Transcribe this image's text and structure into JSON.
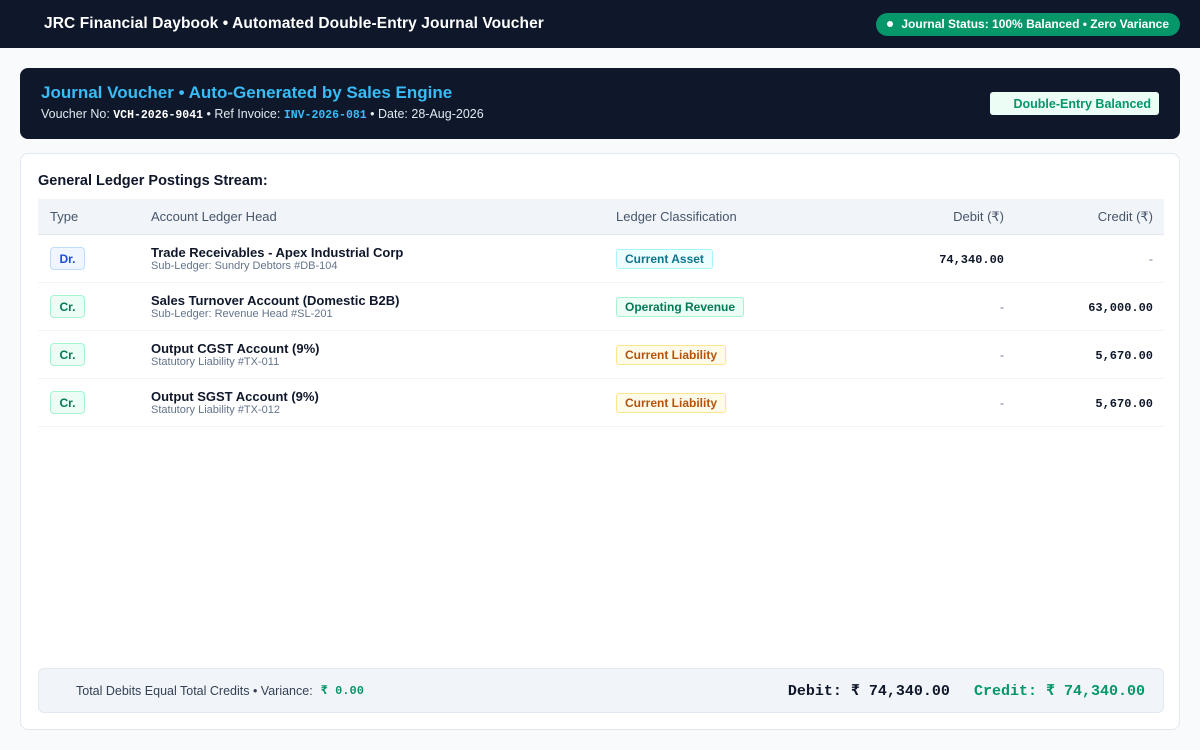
{
  "header": {
    "title": "JRC Financial Daybook • Automated Double-Entry Journal Voucher",
    "status_label": "Journal Status: 100% Balanced • Zero Variance"
  },
  "voucher": {
    "title": "Journal Voucher • Auto-Generated by Sales Engine",
    "voucher_no_label": "Voucher No:",
    "voucher_no": "VCH-2026-9041",
    "ref_invoice_label": "Ref Invoice:",
    "ref_invoice": "INV-2026-081",
    "date_label": "Date:",
    "date": "28-Aug-2026",
    "badge": "Double-Entry Balanced"
  },
  "ledger": {
    "section_title": "General Ledger Postings Stream:",
    "columns": {
      "type": "Type",
      "account": "Account Ledger Head",
      "classification": "Ledger Classification",
      "debit": "Debit (₹)",
      "credit": "Credit (₹)"
    },
    "rows": [
      {
        "type": "Dr.",
        "account": "Trade Receivables - Apex Industrial Corp",
        "sub": "Sub-Ledger: Sundry Debtors #DB-104",
        "classification": "Current Asset",
        "debit": "74,340.00",
        "credit": "-"
      },
      {
        "type": "Cr.",
        "account": "Sales Turnover Account (Domestic B2B)",
        "sub": "Sub-Ledger: Revenue Head #SL-201",
        "classification": "Operating Revenue",
        "debit": "-",
        "credit": "63,000.00"
      },
      {
        "type": "Cr.",
        "account": "Output CGST Account (9%)",
        "sub": "Statutory Liability #TX-011",
        "classification": "Current Liability",
        "debit": "-",
        "credit": "5,670.00"
      },
      {
        "type": "Cr.",
        "account": "Output SGST Account (9%)",
        "sub": "Statutory Liability #TX-012",
        "classification": "Current Liability",
        "debit": "-",
        "credit": "5,670.00"
      }
    ]
  },
  "totals": {
    "label": "Total Debits Equal Total Credits • Variance:",
    "variance": "₹ 0.00",
    "debit_total": "Debit: ₹ 74,340.00",
    "credit_total": "Credit: ₹ 74,340.00"
  },
  "colors": {
    "navy": "#0f172a",
    "accent_blue": "#38bdf8",
    "success_green": "#059669"
  }
}
